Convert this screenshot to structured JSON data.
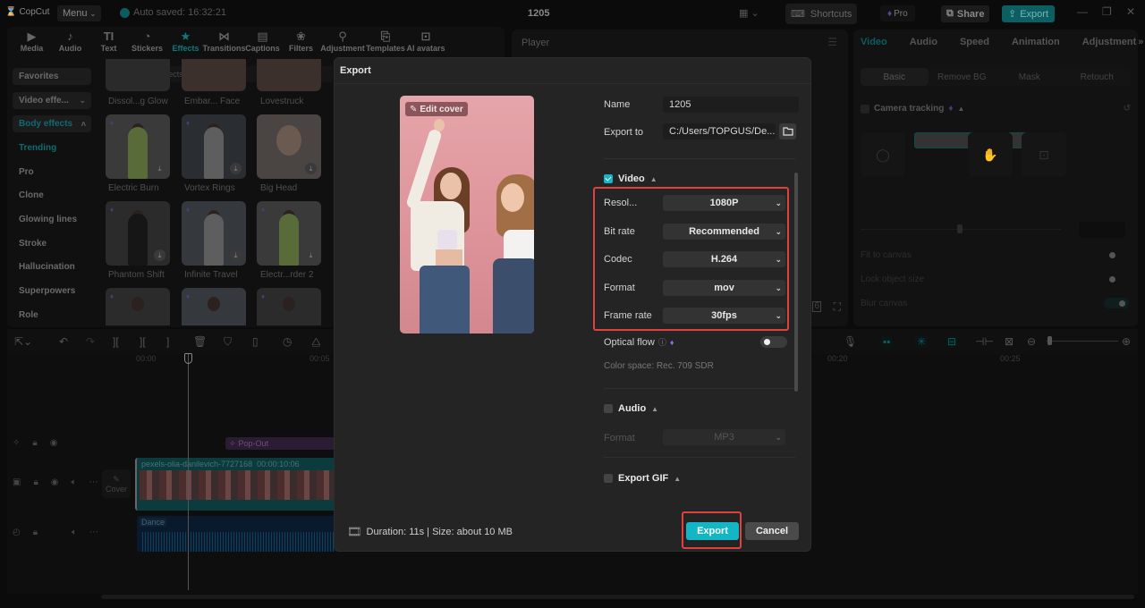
{
  "titlebar": {
    "app_name": "CopCut",
    "menu_label": "Menu",
    "autosave": "Auto saved: 16:32:21",
    "project_title": "1205",
    "shortcuts_label": "Shortcuts",
    "pro_label": "Pro",
    "share_label": "Share",
    "export_label": "Export"
  },
  "tool_tabs": [
    {
      "label": "Media",
      "icon": "media-icon"
    },
    {
      "label": "Audio",
      "icon": "audio-icon"
    },
    {
      "label": "Text",
      "icon": "text-icon"
    },
    {
      "label": "Stickers",
      "icon": "stickers-icon"
    },
    {
      "label": "Effects",
      "icon": "effects-icon",
      "active": true
    },
    {
      "label": "Transitions",
      "icon": "transitions-icon"
    },
    {
      "label": "Captions",
      "icon": "captions-icon"
    },
    {
      "label": "Filters",
      "icon": "filters-icon"
    },
    {
      "label": "Adjustment",
      "icon": "adjustment-icon"
    },
    {
      "label": "Templates",
      "icon": "templates-icon"
    },
    {
      "label": "AI avatars",
      "icon": "ai-avatars-icon"
    }
  ],
  "effects_sidebar": {
    "favorites": "Favorites",
    "video_effects": "Video effe...",
    "body_effects": "Body effects",
    "items": [
      "Trending",
      "Pro",
      "Clone",
      "Glowing lines",
      "Stroke",
      "Hallucination",
      "Superpowers",
      "Role"
    ]
  },
  "effects_panel": {
    "search_placeholder": "Search for effects",
    "top_row": [
      "Dissol...g Glow",
      "Embar... Face",
      "Lovestruck"
    ],
    "items": [
      {
        "name": "Electric Burn",
        "pro": true
      },
      {
        "name": "Vortex Rings",
        "pro": true
      },
      {
        "name": "Big Head",
        "pro": false
      },
      {
        "name": "Phantom Shift",
        "pro": true
      },
      {
        "name": "Infinite Travel",
        "pro": true
      },
      {
        "name": "Electr...rder 2",
        "pro": true
      }
    ]
  },
  "player": {
    "title": "Player"
  },
  "inspector": {
    "tabs": [
      "Video",
      "Audio",
      "Speed",
      "Animation",
      "Adjustment"
    ],
    "active_tab": "Video",
    "sub_tabs": [
      "Basic",
      "Remove BG",
      "Mask",
      "Retouch"
    ],
    "camera_tracking": "Camera tracking",
    "options": [
      {
        "label": "Fit to canvas",
        "on": false
      },
      {
        "label": "Lock object size",
        "on": false
      },
      {
        "label": "Blur canvas",
        "on": true
      }
    ]
  },
  "timeline": {
    "ruler": [
      "00:00",
      "00:05",
      "00:20",
      "00:25"
    ],
    "effect_clip": "Pop-Out",
    "video_clip": {
      "name": "pexels-olia-danilevich-7727168",
      "duration": "00:00:10:06"
    },
    "audio_clip": "Dance",
    "cover_label": "Cover"
  },
  "export_dialog": {
    "title": "Export",
    "edit_cover": "Edit cover",
    "name_label": "Name",
    "name_value": "1205",
    "export_to_label": "Export to",
    "export_to_value": "C:/Users/TOPGUS/De...",
    "video_section": "Video",
    "video_checked": true,
    "settings": [
      {
        "label": "Resol...",
        "value": "1080P"
      },
      {
        "label": "Bit rate",
        "value": "Recommended"
      },
      {
        "label": "Codec",
        "value": "H.264"
      },
      {
        "label": "Format",
        "value": "mov"
      },
      {
        "label": "Frame rate",
        "value": "30fps"
      }
    ],
    "optical_flow_label": "Optical flow",
    "optical_flow_on": false,
    "color_space": "Color space: Rec. 709 SDR",
    "audio_section": "Audio",
    "audio_checked": false,
    "audio_format_label": "Format",
    "audio_format_value": "MP3",
    "gif_section": "Export GIF",
    "gif_checked": false,
    "footer_info": "Duration: 11s | Size: about 10 MB",
    "export_button": "Export",
    "cancel_button": "Cancel"
  },
  "colors": {
    "accent": "#12b6c4",
    "highlight_box": "#e0413f",
    "pro_gem": "#8b6cf0"
  }
}
